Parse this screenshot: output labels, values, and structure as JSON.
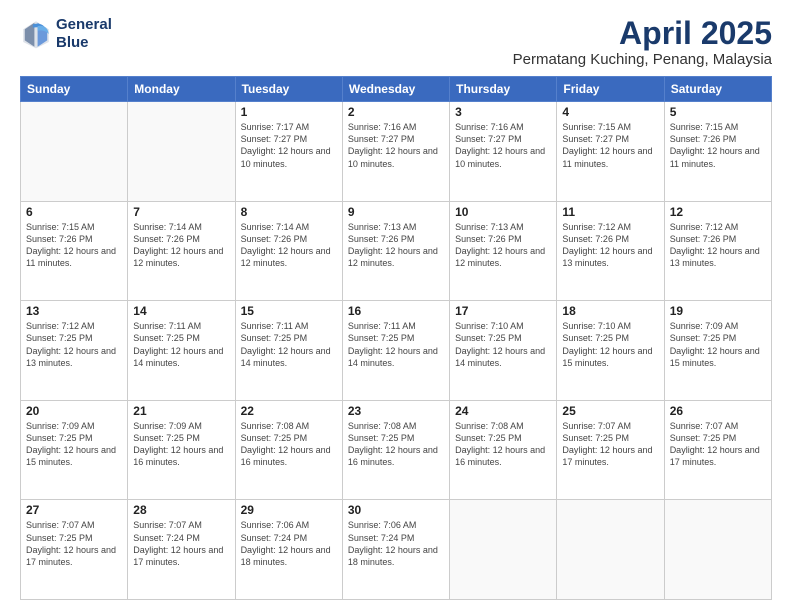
{
  "logo": {
    "line1": "General",
    "line2": "Blue"
  },
  "title": "April 2025",
  "location": "Permatang Kuching, Penang, Malaysia",
  "header_days": [
    "Sunday",
    "Monday",
    "Tuesday",
    "Wednesday",
    "Thursday",
    "Friday",
    "Saturday"
  ],
  "weeks": [
    [
      {
        "day": "",
        "sunrise": "",
        "sunset": "",
        "daylight": ""
      },
      {
        "day": "",
        "sunrise": "",
        "sunset": "",
        "daylight": ""
      },
      {
        "day": "1",
        "sunrise": "Sunrise: 7:17 AM",
        "sunset": "Sunset: 7:27 PM",
        "daylight": "Daylight: 12 hours and 10 minutes."
      },
      {
        "day": "2",
        "sunrise": "Sunrise: 7:16 AM",
        "sunset": "Sunset: 7:27 PM",
        "daylight": "Daylight: 12 hours and 10 minutes."
      },
      {
        "day": "3",
        "sunrise": "Sunrise: 7:16 AM",
        "sunset": "Sunset: 7:27 PM",
        "daylight": "Daylight: 12 hours and 10 minutes."
      },
      {
        "day": "4",
        "sunrise": "Sunrise: 7:15 AM",
        "sunset": "Sunset: 7:27 PM",
        "daylight": "Daylight: 12 hours and 11 minutes."
      },
      {
        "day": "5",
        "sunrise": "Sunrise: 7:15 AM",
        "sunset": "Sunset: 7:26 PM",
        "daylight": "Daylight: 12 hours and 11 minutes."
      }
    ],
    [
      {
        "day": "6",
        "sunrise": "Sunrise: 7:15 AM",
        "sunset": "Sunset: 7:26 PM",
        "daylight": "Daylight: 12 hours and 11 minutes."
      },
      {
        "day": "7",
        "sunrise": "Sunrise: 7:14 AM",
        "sunset": "Sunset: 7:26 PM",
        "daylight": "Daylight: 12 hours and 12 minutes."
      },
      {
        "day": "8",
        "sunrise": "Sunrise: 7:14 AM",
        "sunset": "Sunset: 7:26 PM",
        "daylight": "Daylight: 12 hours and 12 minutes."
      },
      {
        "day": "9",
        "sunrise": "Sunrise: 7:13 AM",
        "sunset": "Sunset: 7:26 PM",
        "daylight": "Daylight: 12 hours and 12 minutes."
      },
      {
        "day": "10",
        "sunrise": "Sunrise: 7:13 AM",
        "sunset": "Sunset: 7:26 PM",
        "daylight": "Daylight: 12 hours and 12 minutes."
      },
      {
        "day": "11",
        "sunrise": "Sunrise: 7:12 AM",
        "sunset": "Sunset: 7:26 PM",
        "daylight": "Daylight: 12 hours and 13 minutes."
      },
      {
        "day": "12",
        "sunrise": "Sunrise: 7:12 AM",
        "sunset": "Sunset: 7:26 PM",
        "daylight": "Daylight: 12 hours and 13 minutes."
      }
    ],
    [
      {
        "day": "13",
        "sunrise": "Sunrise: 7:12 AM",
        "sunset": "Sunset: 7:25 PM",
        "daylight": "Daylight: 12 hours and 13 minutes."
      },
      {
        "day": "14",
        "sunrise": "Sunrise: 7:11 AM",
        "sunset": "Sunset: 7:25 PM",
        "daylight": "Daylight: 12 hours and 14 minutes."
      },
      {
        "day": "15",
        "sunrise": "Sunrise: 7:11 AM",
        "sunset": "Sunset: 7:25 PM",
        "daylight": "Daylight: 12 hours and 14 minutes."
      },
      {
        "day": "16",
        "sunrise": "Sunrise: 7:11 AM",
        "sunset": "Sunset: 7:25 PM",
        "daylight": "Daylight: 12 hours and 14 minutes."
      },
      {
        "day": "17",
        "sunrise": "Sunrise: 7:10 AM",
        "sunset": "Sunset: 7:25 PM",
        "daylight": "Daylight: 12 hours and 14 minutes."
      },
      {
        "day": "18",
        "sunrise": "Sunrise: 7:10 AM",
        "sunset": "Sunset: 7:25 PM",
        "daylight": "Daylight: 12 hours and 15 minutes."
      },
      {
        "day": "19",
        "sunrise": "Sunrise: 7:09 AM",
        "sunset": "Sunset: 7:25 PM",
        "daylight": "Daylight: 12 hours and 15 minutes."
      }
    ],
    [
      {
        "day": "20",
        "sunrise": "Sunrise: 7:09 AM",
        "sunset": "Sunset: 7:25 PM",
        "daylight": "Daylight: 12 hours and 15 minutes."
      },
      {
        "day": "21",
        "sunrise": "Sunrise: 7:09 AM",
        "sunset": "Sunset: 7:25 PM",
        "daylight": "Daylight: 12 hours and 16 minutes."
      },
      {
        "day": "22",
        "sunrise": "Sunrise: 7:08 AM",
        "sunset": "Sunset: 7:25 PM",
        "daylight": "Daylight: 12 hours and 16 minutes."
      },
      {
        "day": "23",
        "sunrise": "Sunrise: 7:08 AM",
        "sunset": "Sunset: 7:25 PM",
        "daylight": "Daylight: 12 hours and 16 minutes."
      },
      {
        "day": "24",
        "sunrise": "Sunrise: 7:08 AM",
        "sunset": "Sunset: 7:25 PM",
        "daylight": "Daylight: 12 hours and 16 minutes."
      },
      {
        "day": "25",
        "sunrise": "Sunrise: 7:07 AM",
        "sunset": "Sunset: 7:25 PM",
        "daylight": "Daylight: 12 hours and 17 minutes."
      },
      {
        "day": "26",
        "sunrise": "Sunrise: 7:07 AM",
        "sunset": "Sunset: 7:25 PM",
        "daylight": "Daylight: 12 hours and 17 minutes."
      }
    ],
    [
      {
        "day": "27",
        "sunrise": "Sunrise: 7:07 AM",
        "sunset": "Sunset: 7:25 PM",
        "daylight": "Daylight: 12 hours and 17 minutes."
      },
      {
        "day": "28",
        "sunrise": "Sunrise: 7:07 AM",
        "sunset": "Sunset: 7:24 PM",
        "daylight": "Daylight: 12 hours and 17 minutes."
      },
      {
        "day": "29",
        "sunrise": "Sunrise: 7:06 AM",
        "sunset": "Sunset: 7:24 PM",
        "daylight": "Daylight: 12 hours and 18 minutes."
      },
      {
        "day": "30",
        "sunrise": "Sunrise: 7:06 AM",
        "sunset": "Sunset: 7:24 PM",
        "daylight": "Daylight: 12 hours and 18 minutes."
      },
      {
        "day": "",
        "sunrise": "",
        "sunset": "",
        "daylight": ""
      },
      {
        "day": "",
        "sunrise": "",
        "sunset": "",
        "daylight": ""
      },
      {
        "day": "",
        "sunrise": "",
        "sunset": "",
        "daylight": ""
      }
    ]
  ]
}
